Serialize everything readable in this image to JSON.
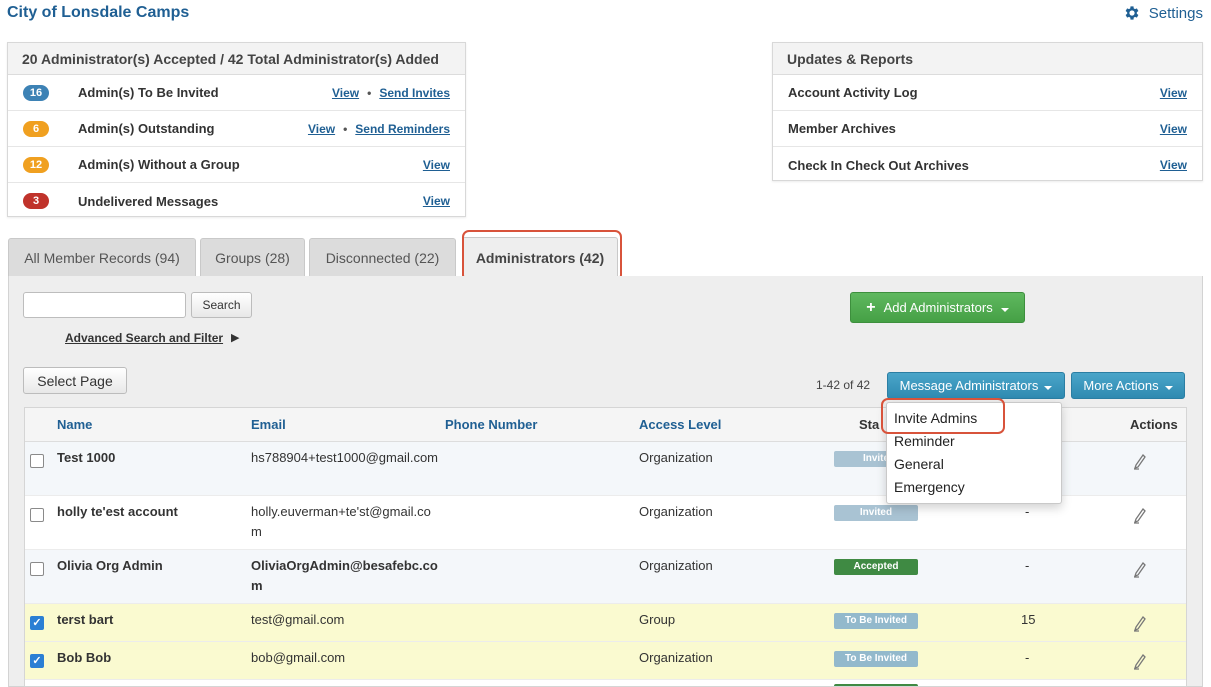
{
  "app": {
    "title": "City of Lonsdale Camps",
    "settings_label": "Settings"
  },
  "summary": {
    "header": "20 Administrator(s) Accepted / 42 Total Administrator(s) Added",
    "rows": [
      {
        "count": "16",
        "label": "Admin(s) To Be Invited",
        "link1": "View",
        "link2": "Send Invites",
        "color": "#3d82b5"
      },
      {
        "count": "6",
        "label": "Admin(s) Outstanding",
        "link1": "View",
        "link2": "Send Reminders",
        "color": "#f0a020"
      },
      {
        "count": "12",
        "label": "Admin(s) Without a Group",
        "link1": "View",
        "color": "#f0a020"
      },
      {
        "count": "3",
        "label": "Undelivered Messages",
        "link1": "View",
        "color": "#c0332b"
      }
    ]
  },
  "reports": {
    "header": "Updates & Reports",
    "rows": [
      {
        "label": "Account Activity Log",
        "link": "View"
      },
      {
        "label": "Member Archives",
        "link": "View"
      },
      {
        "label": "Check In Check Out Archives",
        "link": "View"
      }
    ]
  },
  "tabs": [
    {
      "label": "All Member Records (94)"
    },
    {
      "label": "Groups (28)"
    },
    {
      "label": "Disconnected (22)"
    },
    {
      "label": "Administrators (42)",
      "active": true
    }
  ],
  "toolbar": {
    "search_value": "",
    "search_button": "Search",
    "advanced_link": "Advanced Search and Filter",
    "add_button": "Add Administrators",
    "select_page": "Select Page",
    "count_text": "1-42 of 42",
    "message_button": "Message Administrators",
    "more_button": "More Actions"
  },
  "dropdown": {
    "items": [
      "Invite Admins",
      "Reminder",
      "General",
      "Emergency"
    ]
  },
  "table": {
    "columns": {
      "name": "Name",
      "email": "Email",
      "phone": "Phone Number",
      "access": "Access Level",
      "status": "Sta",
      "actions": "Actions"
    },
    "rows": [
      {
        "checked": false,
        "name": "Test 1000",
        "email": "hs788904+test1000@gmail.com",
        "phone": "",
        "access": "Organization",
        "status": "Invite",
        "status_kind": "invited",
        "group_count": ""
      },
      {
        "checked": false,
        "name": "holly te'est account",
        "email": "holly.euverman+te'st@gmail.com",
        "phone": "",
        "access": "Organization",
        "status": "Invited",
        "status_kind": "invited",
        "group_count": "-"
      },
      {
        "checked": false,
        "name": "Olivia Org Admin",
        "email": "OliviaOrgAdmin@besafebc.com",
        "phone": "",
        "access": "Organization",
        "status": "Accepted",
        "status_kind": "accepted",
        "group_count": "-"
      },
      {
        "checked": true,
        "name": "terst bart",
        "email": "test@gmail.com",
        "phone": "",
        "access": "Group",
        "status": "To Be Invited",
        "status_kind": "tobe",
        "group_count": "15"
      },
      {
        "checked": true,
        "name": "Bob Bob",
        "email": "bob@gmail.com",
        "phone": "",
        "access": "Organization",
        "status": "To Be Invited",
        "status_kind": "tobe",
        "group_count": "-"
      }
    ]
  },
  "colors": {
    "brand_blue": "#1f5f93",
    "highlight": "#d8533b",
    "green": "#45a045",
    "teal": "#2f8ab1"
  }
}
